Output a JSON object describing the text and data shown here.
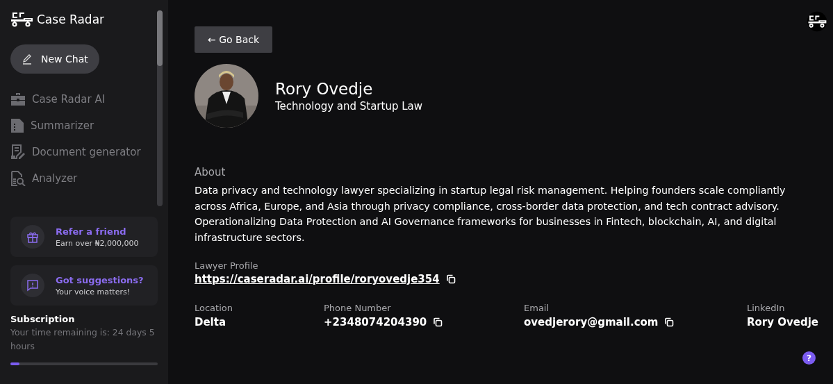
{
  "sidebar": {
    "brand": "Case Radar",
    "new_chat": "New Chat",
    "nav": [
      {
        "label": "Case Radar AI",
        "kind": "briefcase"
      },
      {
        "label": "Summarizer",
        "kind": "file"
      },
      {
        "label": "Document generator",
        "kind": "doc-edit"
      },
      {
        "label": "Analyzer",
        "kind": "doc-search"
      }
    ],
    "cards": [
      {
        "title": "Refer a friend",
        "subtitle": "Earn over ₦2,000,000",
        "kind": "gift"
      },
      {
        "title": "Got suggestions?",
        "subtitle": "Your voice matters!",
        "kind": "feedback"
      }
    ],
    "subscription": {
      "title": "Subscription",
      "text": "Your time remaining is: 24 days 5 hours",
      "level": 0.06
    }
  },
  "profile": {
    "back": "← Go Back",
    "name": "Rory Ovedje",
    "specialty": "Technology and Startup Law",
    "about_label": "About",
    "about": "Data privacy and technology lawyer specializing in startup legal risk management. Helping founders scale compliantly across Africa, Europe, and Asia through privacy compliance, cross-border data protection, and tech contract advisory. Operationalizing Data Protection and AI Governance frameworks for businesses in Fintech, blockchain, AI, and digital infrastructure sectors.",
    "link_label": "Lawyer Profile",
    "link": "https://caseradar.ai/profile/roryovedje354",
    "fields": [
      {
        "label": "Location",
        "value": "Delta",
        "copy": false
      },
      {
        "label": "Phone Number",
        "value": "+2348074204390",
        "copy": true
      },
      {
        "label": "Email",
        "value": "ovedjerory@gmail.com",
        "copy": true
      },
      {
        "label": "LinkedIn",
        "value": "Rory Ovedje",
        "copy": false
      }
    ],
    "help": "?"
  }
}
